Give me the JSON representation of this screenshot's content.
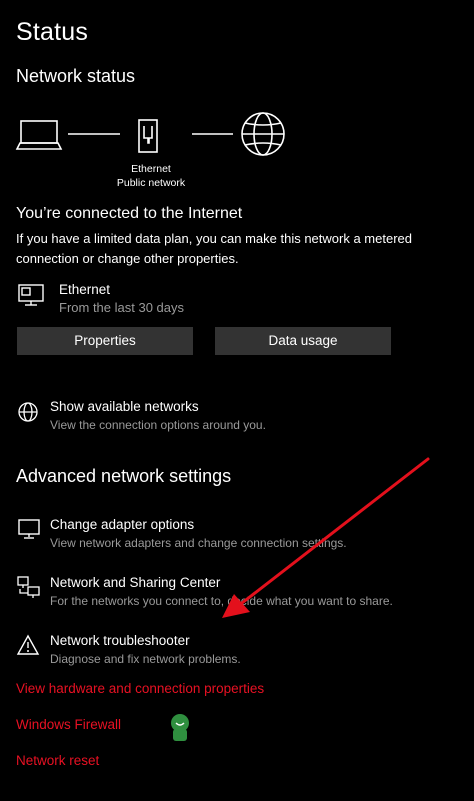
{
  "page": {
    "title": "Status"
  },
  "network_status": {
    "heading": "Network status",
    "diagram": {
      "adapter_name": "Ethernet",
      "network_type": "Public network"
    },
    "connected_title": "You’re connected to the Internet",
    "connected_desc": "If you have a limited data plan, you can make this network a metered connection or change other properties.",
    "connection": {
      "name": "Ethernet",
      "detail": "From the last 30 days",
      "icon": "ethernet-pc-icon"
    },
    "buttons": {
      "properties": "Properties",
      "data_usage": "Data usage"
    },
    "show_networks": {
      "title": "Show available networks",
      "desc": "View the connection options around you.",
      "icon": "globe-icon"
    }
  },
  "advanced": {
    "heading": "Advanced network settings",
    "items": [
      {
        "title": "Change adapter options",
        "desc": "View network adapters and change connection settings.",
        "icon": "monitor-icon"
      },
      {
        "title": "Network and Sharing Center",
        "desc": "For the networks you connect to, decide what you want to share.",
        "icon": "sharing-center-icon"
      },
      {
        "title": "Network troubleshooter",
        "desc": "Diagnose and fix network problems.",
        "icon": "warning-icon"
      }
    ]
  },
  "links": [
    "View hardware and connection properties",
    "Windows Firewall",
    "Network reset"
  ],
  "colors": {
    "background": "#000000",
    "link": "#e81123",
    "button": "#333333",
    "annotation_arrow": "#e3101c"
  }
}
